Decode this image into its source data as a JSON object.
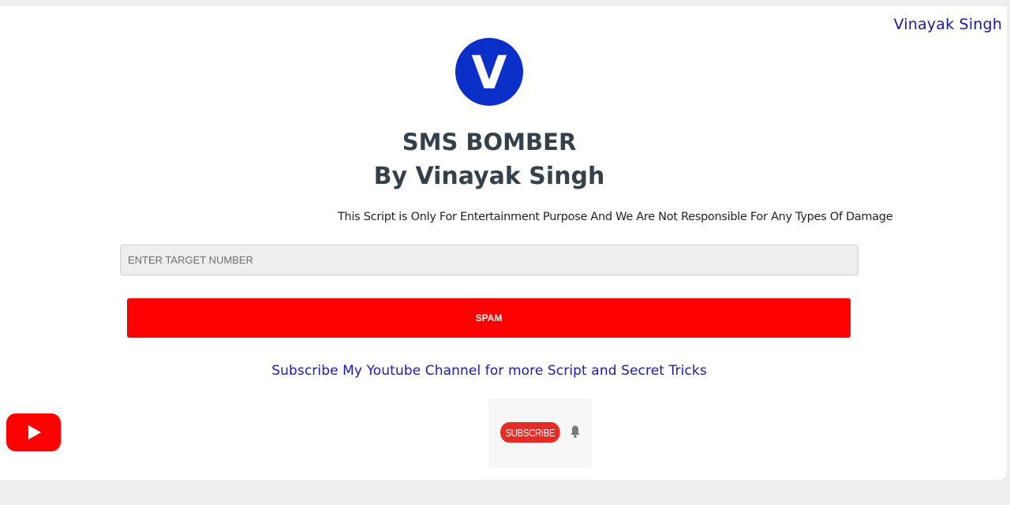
{
  "header": {
    "corner_name": "Vinayak Singh"
  },
  "logo": {
    "letter": "V",
    "color": "#0b2fc9"
  },
  "main": {
    "title": "SMS BOMBER",
    "subtitle": "By Vinayak Singh",
    "disclaimer": "This Script is Only For Entertainment Purpose And We Are Not Responsible For Any Types Of Damage",
    "target_input": {
      "placeholder": "ENTER TARGET NUMBER",
      "value": ""
    },
    "spam_button_label": "SPAM",
    "subscribe_text": "Subscribe My Youtube Channel for more Script and Secret Tricks"
  },
  "footer": {
    "youtube_icon": "youtube-play-icon",
    "subscribe_label": "SUBSCRIBE",
    "bell_icon": "bell-icon"
  },
  "colors": {
    "accent_red": "#ff0000",
    "link_blue": "#1a1ab4",
    "title_gray": "#34404a"
  }
}
